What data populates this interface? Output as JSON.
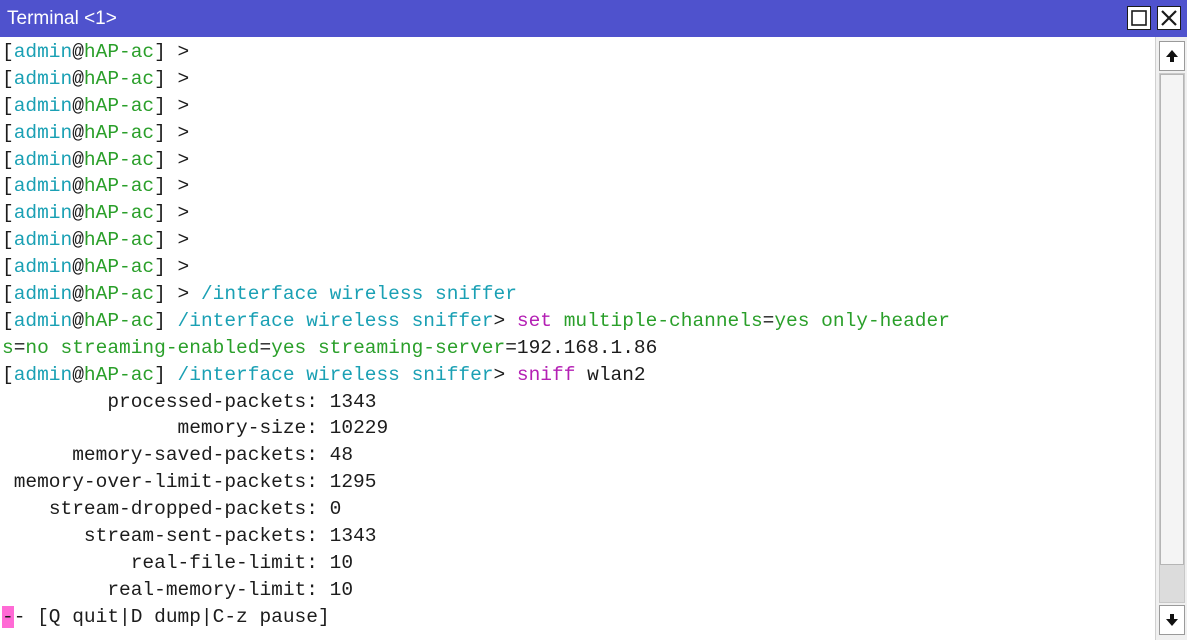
{
  "window": {
    "title": "Terminal <1>",
    "controls": {
      "maximize_icon": "maximize-icon",
      "close_icon": "close-icon"
    }
  },
  "prompt": {
    "open": "[",
    "user": "admin",
    "at": "@",
    "host": "hAP-ac",
    "close": "]",
    "arrow": ">",
    "sniffer_path": "/interface wireless sniffer"
  },
  "terminal": {
    "empty_prompt_lines": 9,
    "command_1": "/interface wireless sniffer",
    "command_2": {
      "keyword": "set",
      "args": [
        {
          "param": "multiple-channels",
          "value": "yes"
        },
        {
          "param": "only-header",
          "value": "no",
          "wrap_split": "s"
        },
        {
          "param": "streaming-enabled",
          "value": "yes"
        },
        {
          "param": "streaming-server",
          "value": "192.168.1.86"
        }
      ],
      "line_1_tail": "only-header",
      "line_2_head": "s"
    },
    "command_3": {
      "keyword": "sniff",
      "arg": "wlan2"
    },
    "stats": [
      {
        "label": "processed-packets",
        "value": "1343"
      },
      {
        "label": "memory-size",
        "value": "10229"
      },
      {
        "label": "memory-saved-packets",
        "value": "48"
      },
      {
        "label": "memory-over-limit-packets",
        "value": "1295"
      },
      {
        "label": "stream-dropped-packets",
        "value": "0"
      },
      {
        "label": "stream-sent-packets",
        "value": "1343"
      },
      {
        "label": "real-file-limit",
        "value": "10"
      },
      {
        "label": "real-memory-limit",
        "value": "10"
      }
    ],
    "status_line": {
      "cursor": "-",
      "text": "- [Q quit|D dump|C-z pause]"
    }
  },
  "scrollbar": {
    "up_icon": "arrow-up-icon",
    "down_icon": "arrow-down-icon",
    "thumb_position": 0.0,
    "thumb_fraction": 0.93
  },
  "colors": {
    "titlebar": "#4f52cd",
    "user": "#1aa0b4",
    "host": "#2a9f2a",
    "keyword": "#b420b4",
    "cursor": "#ff6ad5"
  }
}
